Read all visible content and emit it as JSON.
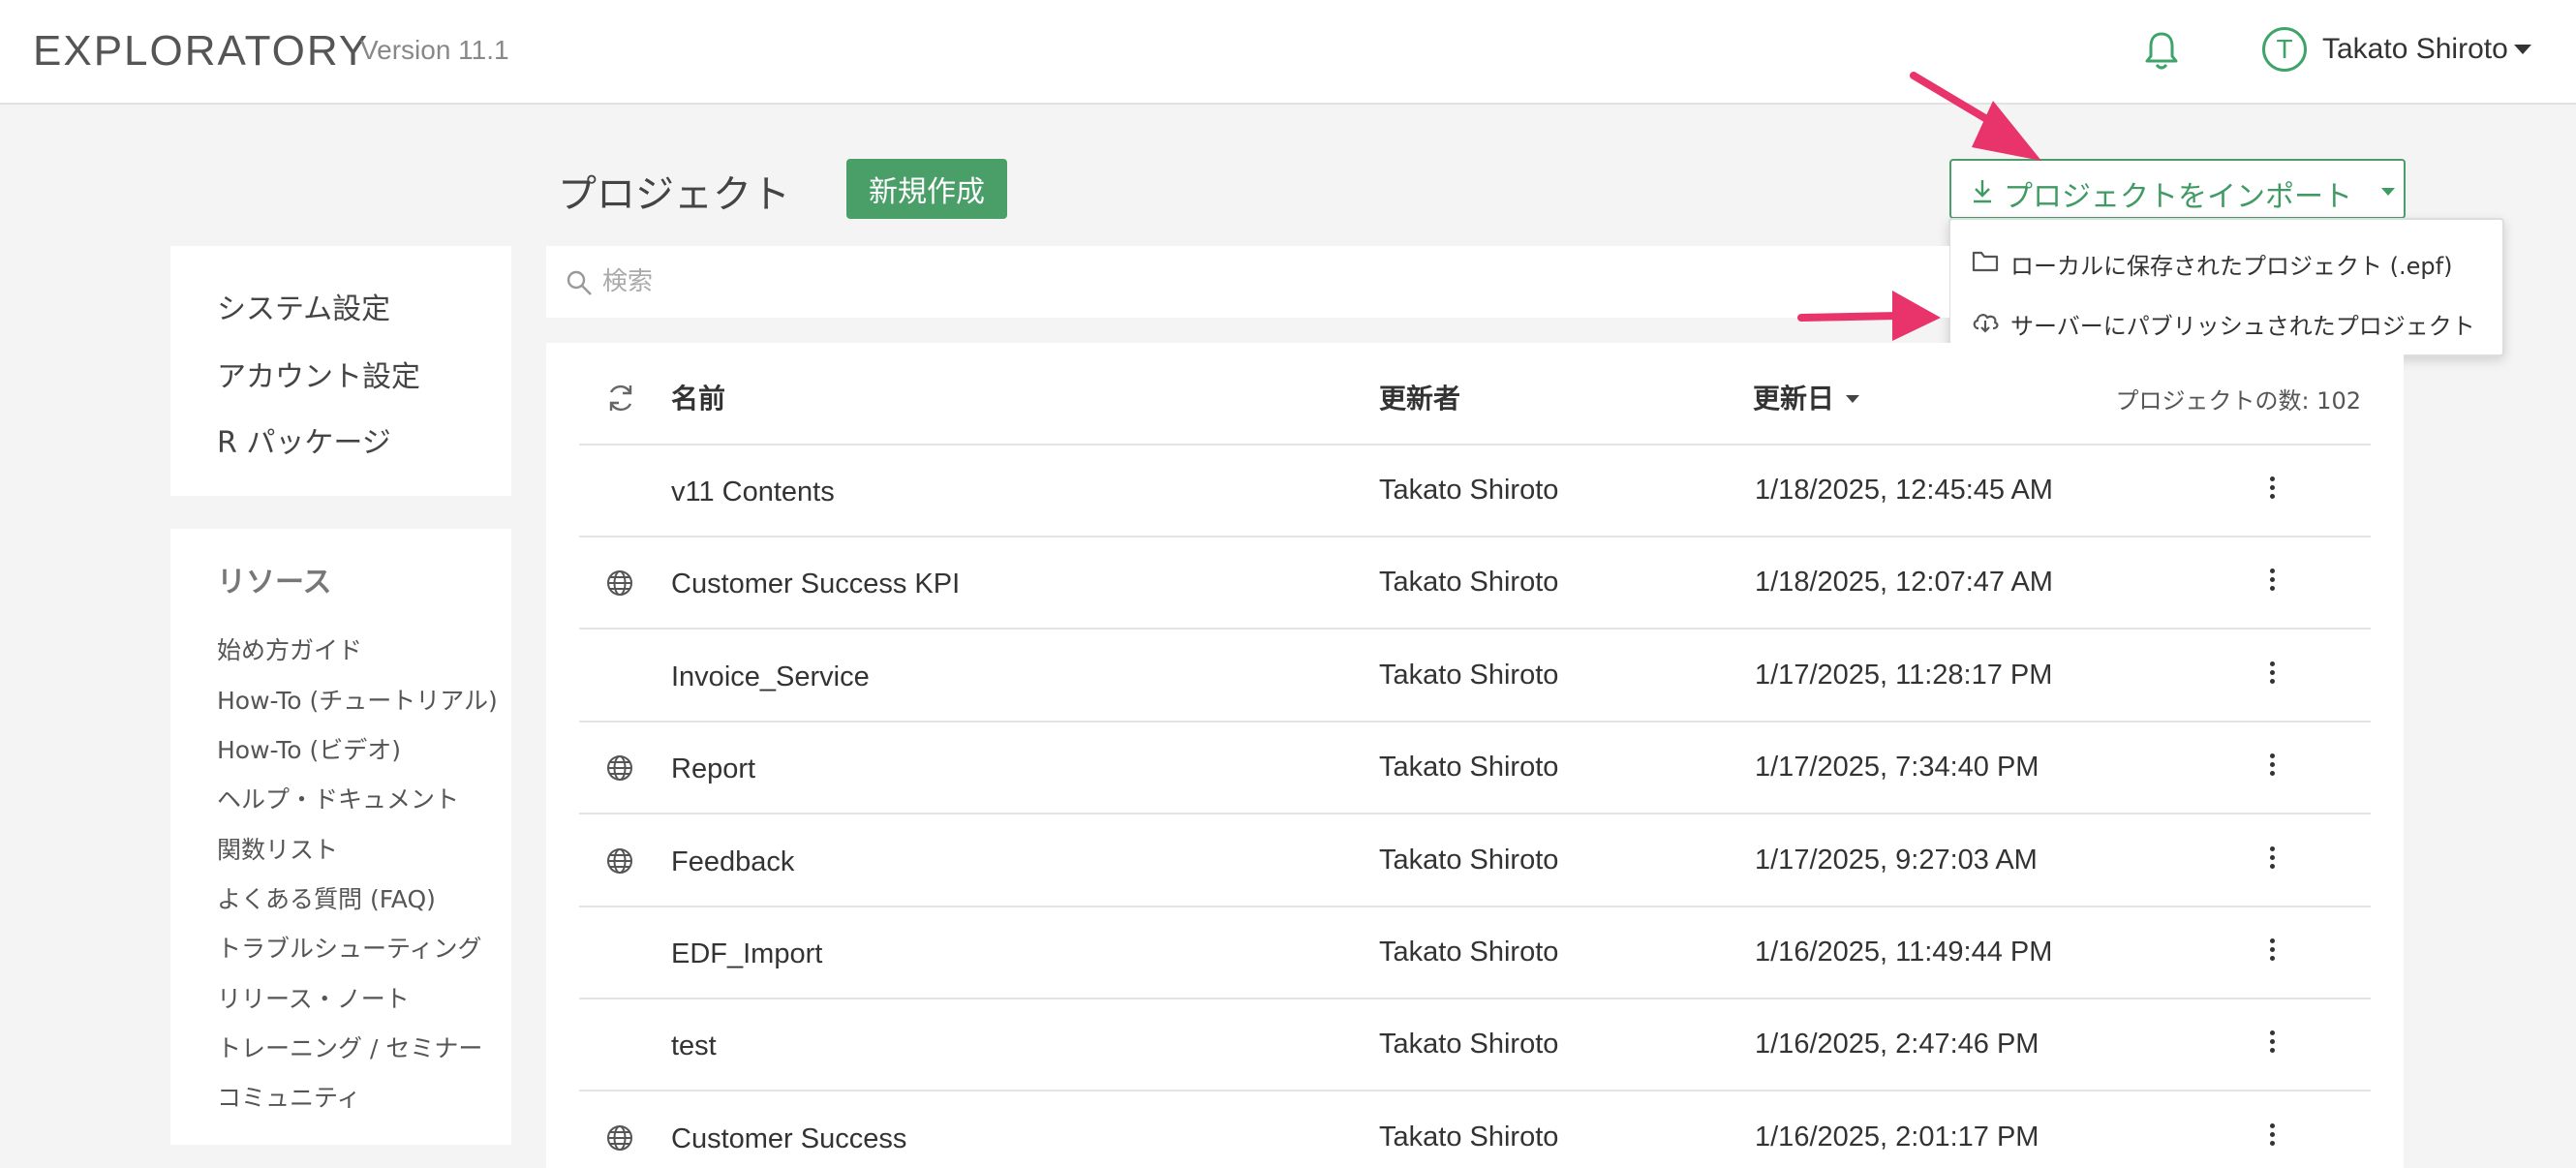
{
  "header": {
    "brand": "EXPLORATORY",
    "version": "Version 11.1",
    "user_initial": "T",
    "user_name": "Takato Shiroto"
  },
  "page": {
    "title": "プロジェクト",
    "new_button": "新規作成",
    "import_button": "プロジェクトをインポート",
    "import_menu": [
      {
        "label": "ローカルに保存されたプロジェクト (.epf)",
        "icon": "folder-icon"
      },
      {
        "label": "サーバーにパブリッシュされたプロジェクト",
        "icon": "cloud-download-icon"
      }
    ]
  },
  "sidebar": {
    "settings": [
      "システム設定",
      "アカウント設定",
      "R パッケージ"
    ],
    "resources_title": "リソース",
    "resources": [
      "始め方ガイド",
      "How-To (チュートリアル)",
      "How-To (ビデオ)",
      "ヘルプ・ドキュメント",
      "関数リスト",
      "よくある質問 (FAQ)",
      "トラブルシューティング",
      "リリース・ノート",
      "トレーニング / セミナー",
      "コミュニティ"
    ]
  },
  "search": {
    "placeholder": "検索"
  },
  "table": {
    "headers": {
      "name": "名前",
      "updated_by": "更新者",
      "updated_at": "更新日"
    },
    "count_label": "プロジェクトの数: 102",
    "rows": [
      {
        "name": "v11 Contents",
        "user": "Takato Shiroto",
        "date": "1/18/2025, 12:45:45 AM",
        "published": false
      },
      {
        "name": "Customer Success KPI",
        "user": "Takato Shiroto",
        "date": "1/18/2025, 12:07:47 AM",
        "published": true
      },
      {
        "name": "Invoice_Service",
        "user": "Takato Shiroto",
        "date": "1/17/2025, 11:28:17 PM",
        "published": false
      },
      {
        "name": "Report",
        "user": "Takato Shiroto",
        "date": "1/17/2025, 7:34:40 PM",
        "published": true
      },
      {
        "name": "Feedback",
        "user": "Takato Shiroto",
        "date": "1/17/2025, 9:27:03 AM",
        "published": true
      },
      {
        "name": "EDF_Import",
        "user": "Takato Shiroto",
        "date": "1/16/2025, 11:49:44 PM",
        "published": false
      },
      {
        "name": "test",
        "user": "Takato Shiroto",
        "date": "1/16/2025, 2:47:46 PM",
        "published": false
      },
      {
        "name": "Customer Success",
        "user": "Takato Shiroto",
        "date": "1/16/2025, 2:01:17 PM",
        "published": true
      }
    ]
  },
  "colors": {
    "accent": "#4a9f69",
    "annotation_arrow": "#e8336b"
  }
}
